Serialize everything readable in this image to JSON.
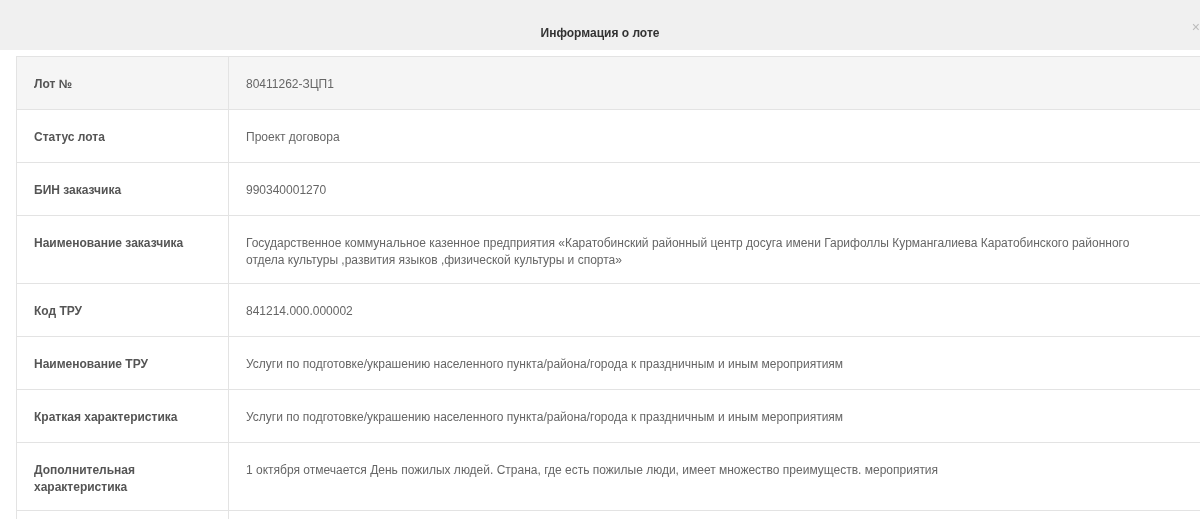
{
  "dialog": {
    "title": "Информация о лоте",
    "close": "×"
  },
  "rows": [
    {
      "label": "Лот №",
      "value": "80411262-ЗЦП1"
    },
    {
      "label": "Статус лота",
      "value": "Проект договора"
    },
    {
      "label": "БИН заказчика",
      "value": "990340001270"
    },
    {
      "label": "Наименование заказчика",
      "value": "Государственное коммунальное казенное предприятия «Каратобинский районный центр досуга имени Гарифоллы Курмангалиева Каратобинского районного отдела культуры ,развития языков ,физической культуры и спорта»"
    },
    {
      "label": "Код ТРУ",
      "value": "841214.000.000002"
    },
    {
      "label": "Наименование ТРУ",
      "value": "Услуги по подготовке/украшению населенного пункта/района/города к праздничным и иным мероприятиям"
    },
    {
      "label": "Краткая характеристика",
      "value": "Услуги по подготовке/украшению населенного пункта/района/города к праздничным и иным мероприятиям"
    },
    {
      "label": "Дополнительная характеристика",
      "value": "1 октября отмечается День пожилых людей. Страна, где есть пожилые люди, имеет множество преимуществ. мероприятия"
    }
  ]
}
